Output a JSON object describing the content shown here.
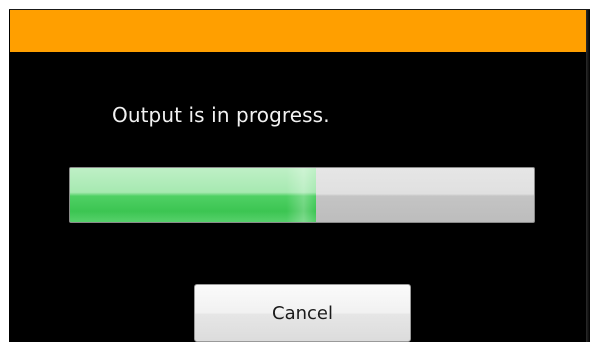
{
  "dialog": {
    "message": "Output is in progress.",
    "progress_fraction": 0.53,
    "cancel_label": "Cancel"
  },
  "colors": {
    "title_bar": "#ff9f00",
    "background": "#000000",
    "message_text": "#f2f2f2",
    "progress_fill": "#3cc552",
    "progress_track": "#d0d0d0"
  }
}
